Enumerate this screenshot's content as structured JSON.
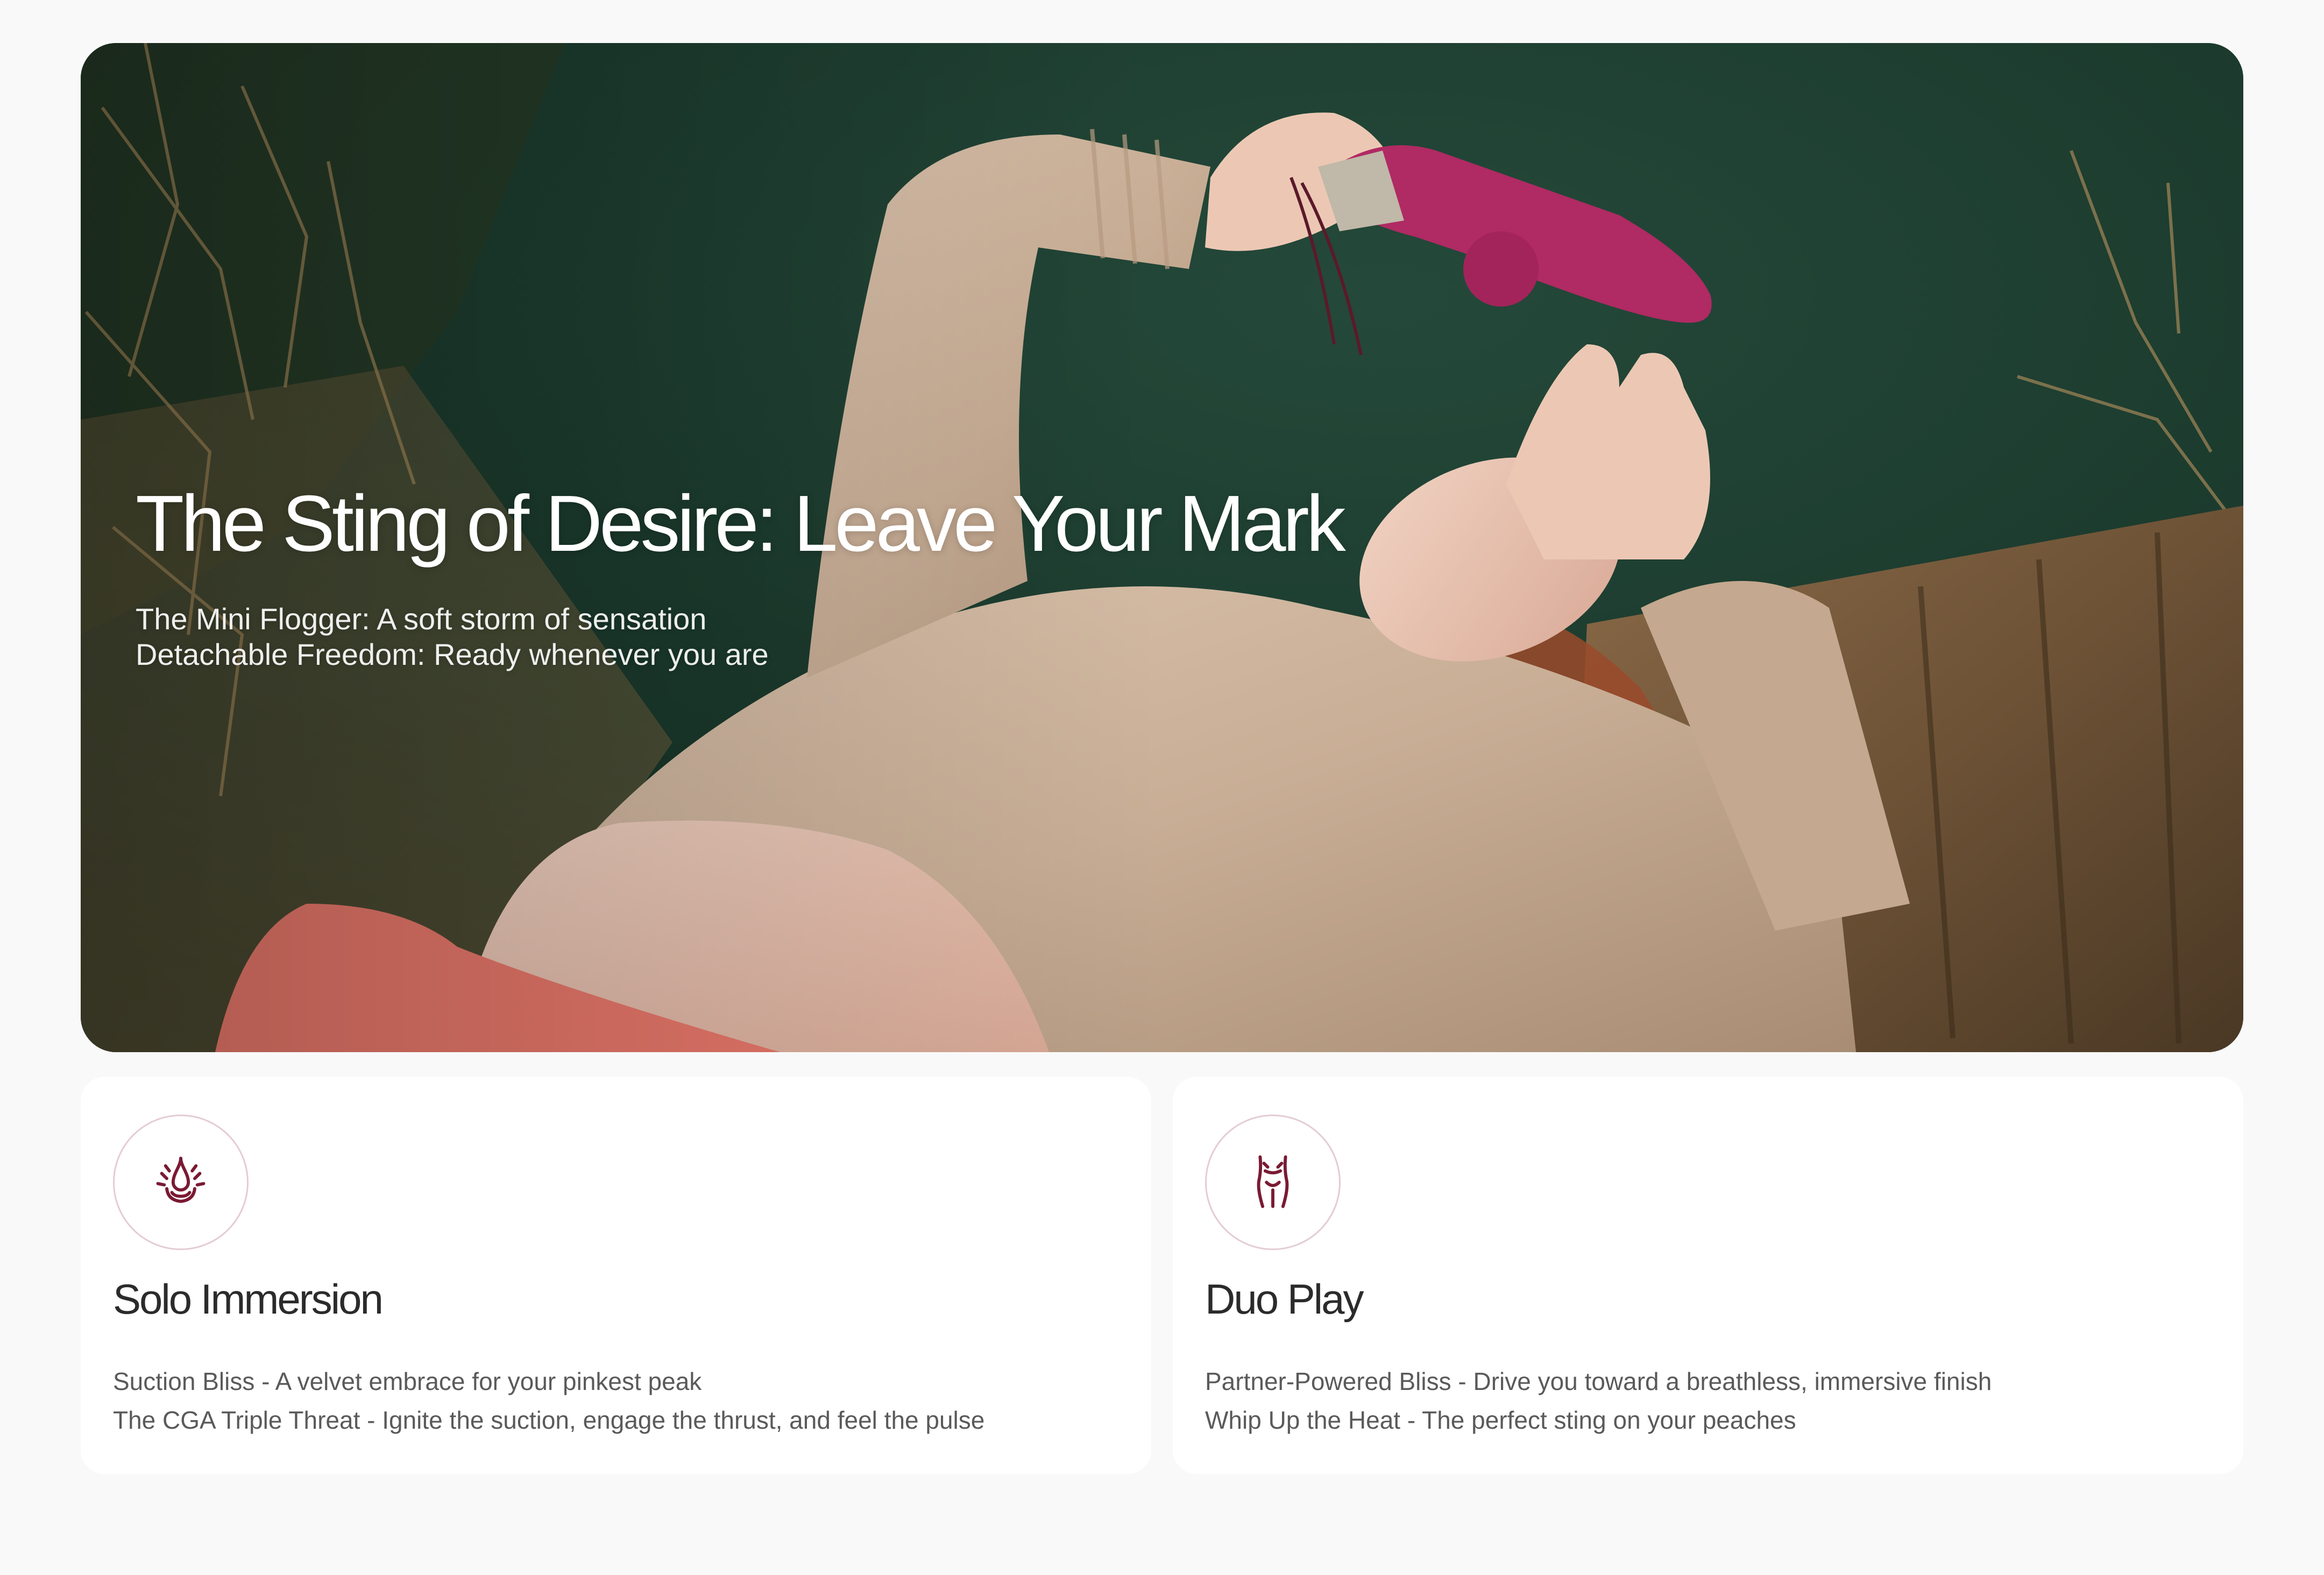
{
  "hero": {
    "title": "The Sting of Desire: Leave Your Mark",
    "lines": [
      "The Mini Flogger: A soft storm of sensation",
      "Detachable Freedom: Ready whenever you are"
    ]
  },
  "cards": [
    {
      "icon": "water-drop-splash-icon",
      "title": "Solo Immersion",
      "lines": [
        "Suction Bliss - A velvet embrace for your pinkest peak",
        "The CGA Triple Threat - Ignite the suction, engage the thrust, and feel the pulse"
      ]
    },
    {
      "icon": "body-silhouette-icon",
      "title": "Duo Play",
      "lines": [
        "Partner-Powered Bliss - Drive you toward a breathless, immersive finish",
        "Whip Up the Heat - The perfect sting on your peaches"
      ]
    }
  ],
  "colors": {
    "page_background": "#f9f9f9",
    "card_background": "#ffffff",
    "icon_accent": "#7a1a33",
    "icon_ring": "#e4ccd3",
    "hero_dark_green": "#1c3a2c",
    "product_pink": "#b02a63",
    "sweater_beige": "#cfb6a0"
  }
}
